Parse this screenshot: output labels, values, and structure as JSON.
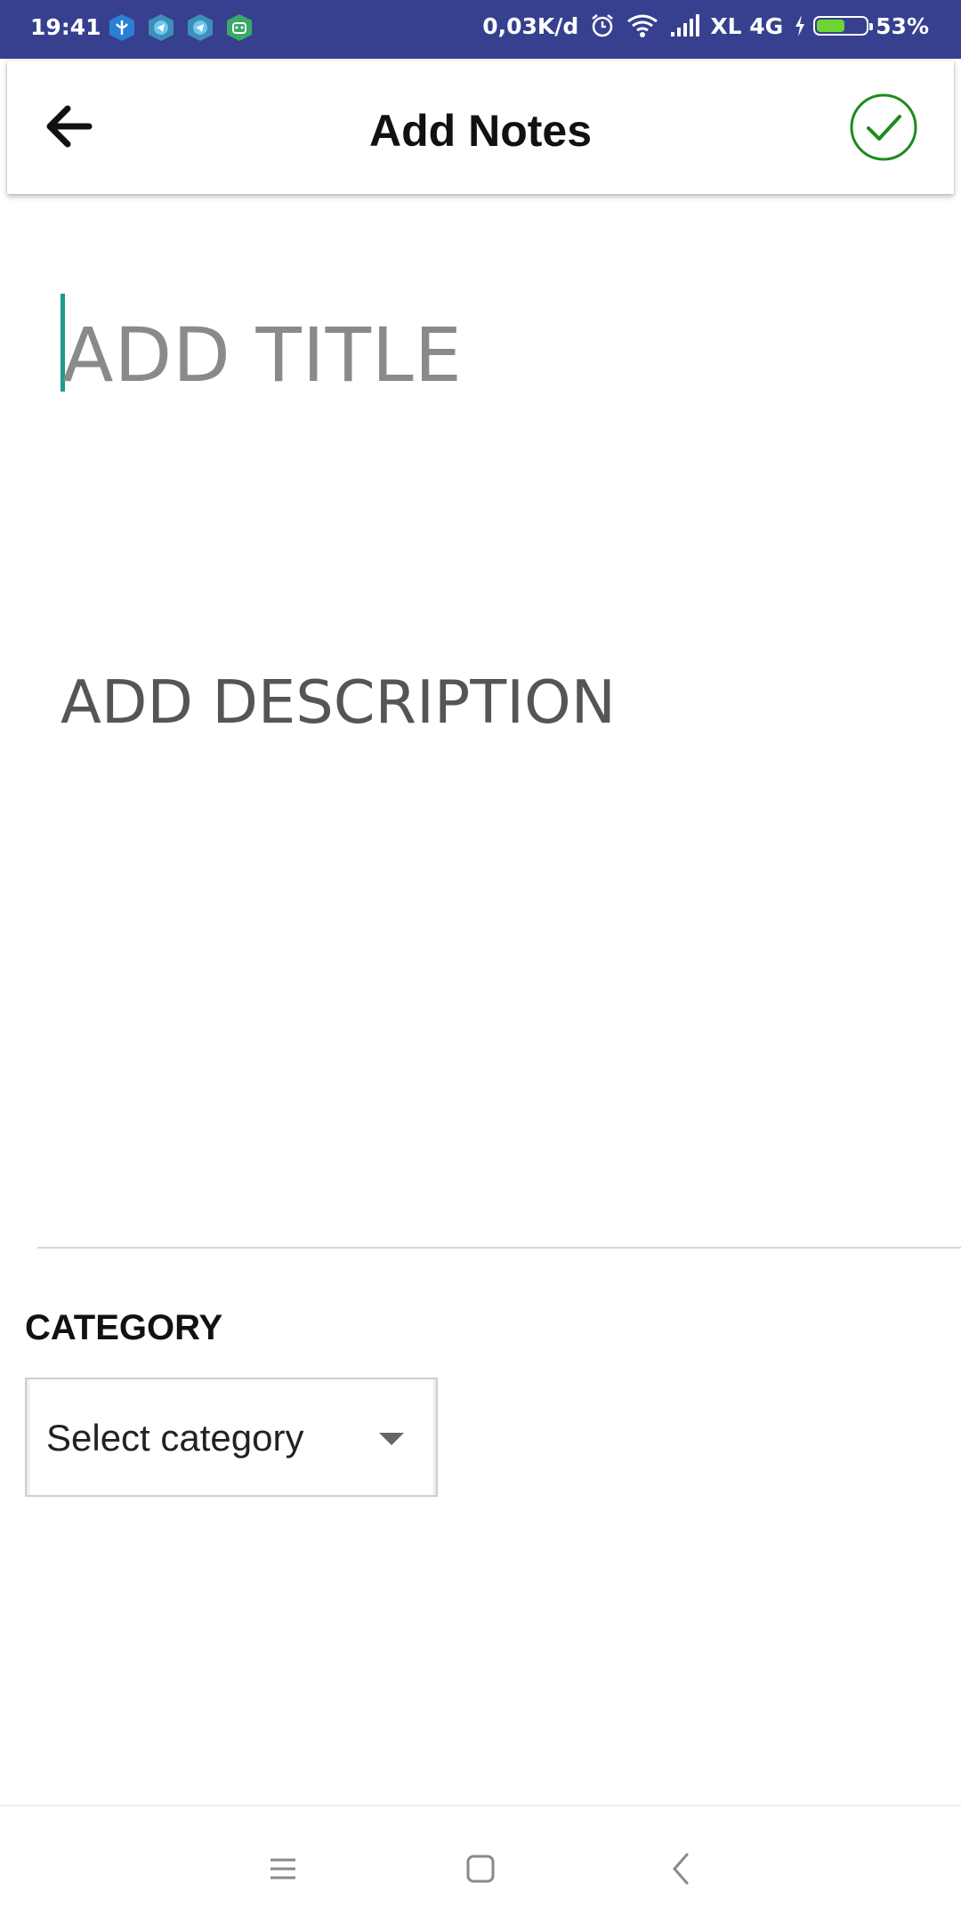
{
  "status_bar": {
    "time": "19:41",
    "app_icons": [
      "shield-app-icon",
      "telegram-icon",
      "telegram-icon",
      "android-robot-icon"
    ],
    "net_speed": "0,03K/d",
    "carrier": "XL 4G",
    "battery_percent": "53%",
    "battery_level": 0.53,
    "icons": [
      "alarm-icon",
      "wifi-icon",
      "signal-icon",
      "charging-icon",
      "battery-icon"
    ]
  },
  "appbar": {
    "title": "Add Notes",
    "back_icon": "arrow-back-icon",
    "done_icon": "check-circle-icon",
    "accent": "#1e8a1e"
  },
  "form": {
    "title_placeholder": "ADD TITLE",
    "description_placeholder": "ADD DESCRIPTION",
    "category_label": "CATEGORY",
    "category_selected": "Select category"
  },
  "colors": {
    "status_bar": "#36408f",
    "caret": "#1f9a8a"
  },
  "nav_bar": {
    "icons": [
      "menu-icon",
      "home-square-icon",
      "back-chevron-icon"
    ]
  }
}
